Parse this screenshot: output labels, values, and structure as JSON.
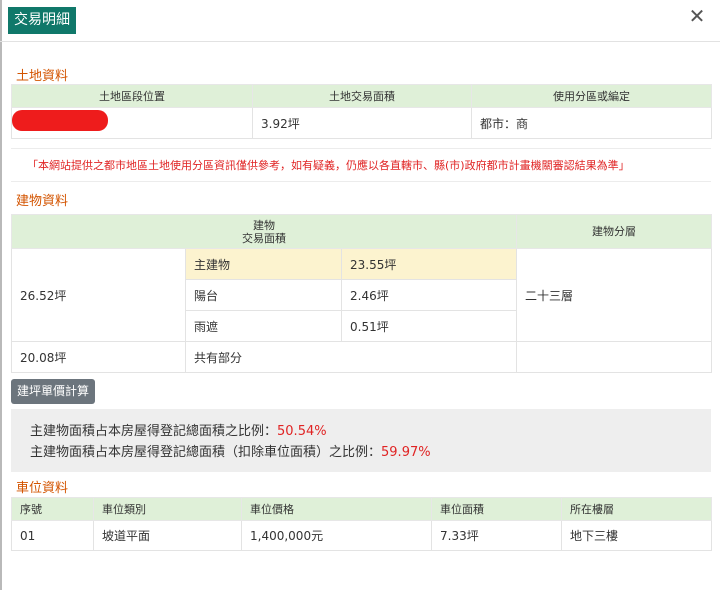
{
  "header": {
    "title": "交易明細",
    "close_symbol": "✕"
  },
  "land": {
    "section_title": "土地資料",
    "columns": [
      "土地區段位置",
      "土地交易面積",
      "使用分區或編定"
    ],
    "row": {
      "location": "",
      "area": "3.92坪",
      "zoning": "都市：商"
    }
  },
  "notice": "「本網站提供之都市地區土地使用分區資訊僅供參考，如有疑義，仍應以各直轄市、縣(市)政府都市計畫機關審認結果為準」",
  "building": {
    "section_title": "建物資料",
    "header_area_line1": "建物",
    "header_area_line2": "交易面積",
    "header_floor": "建物分層",
    "total_area": "26.52坪",
    "main_label": "主建物",
    "main_value": "23.55坪",
    "balcony_label": "陽台",
    "balcony_value": "2.46坪",
    "canopy_label": "雨遮",
    "canopy_value": "0.51坪",
    "floor": "二十三層",
    "shared_area": "20.08坪",
    "shared_label": "共有部分"
  },
  "calc_button": "建坪單價計算",
  "ratios": {
    "line1_label": "主建物面積占本房屋得登記總面積之比例：",
    "line1_value": "50.54%",
    "line2_label": "主建物面積占本房屋得登記總面積（扣除車位面積）之比例：",
    "line2_value": "59.97%"
  },
  "parking": {
    "section_title": "車位資料",
    "columns": [
      "序號",
      "車位類別",
      "車位價格",
      "車位面積",
      "所在樓層"
    ],
    "rows": [
      {
        "no": "01",
        "type": "坡道平面",
        "price": "1,400,000元",
        "area": "7.33坪",
        "floor": "地下三樓"
      }
    ]
  },
  "colors": {
    "accent": "#10786a",
    "section_title": "#d35400",
    "alert": "#e02424",
    "header_bg": "#dff0d8",
    "highlight": "#fcf3cf"
  }
}
